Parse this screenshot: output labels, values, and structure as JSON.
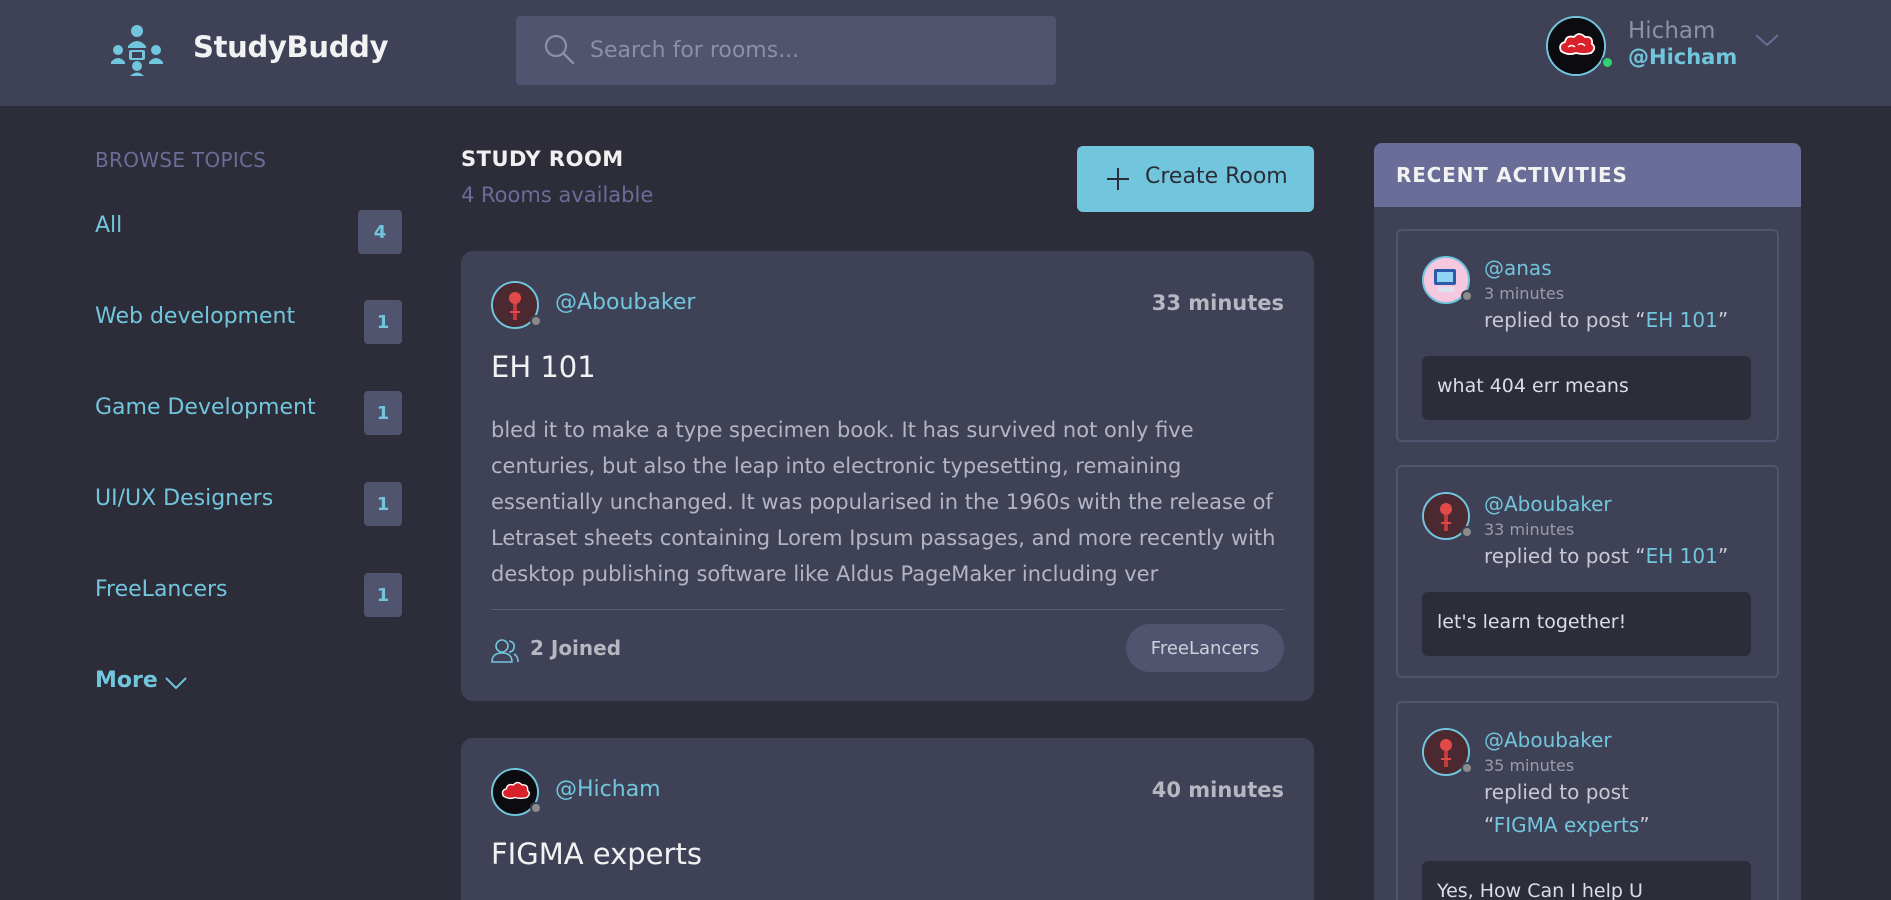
{
  "header": {
    "brand": "StudyBuddy",
    "search_placeholder": "Search for rooms...",
    "user_name": "Hicham",
    "user_handle": "@Hicham"
  },
  "sidebar": {
    "title": "BROWSE TOPICS",
    "topics": [
      {
        "label": "All",
        "count": "4"
      },
      {
        "label": "Web development",
        "count": "1"
      },
      {
        "label": "Game Development",
        "count": "1"
      },
      {
        "label": "UI/UX Designers",
        "count": "1"
      },
      {
        "label": "FreeLancers",
        "count": "1"
      }
    ],
    "more_label": "More"
  },
  "main": {
    "title": "STUDY ROOM",
    "subtitle": "4 Rooms available",
    "create_label": "Create Room",
    "rooms": [
      {
        "host": "@Aboubaker",
        "time": "33 minutes",
        "title": "EH 101",
        "description": "bled it to make a type specimen book. It has survived not only five centuries, but also the leap into electronic typesetting, remaining essentially unchanged. It was popularised in the 1960s with the release of Letraset sheets containing Lorem Ipsum passages, and more recently with desktop publishing software like Aldus PageMaker including ver",
        "joined": "2 Joined",
        "topic": "FreeLancers"
      },
      {
        "host": "@Hicham",
        "time": "40 minutes",
        "title": "FIGMA experts"
      }
    ]
  },
  "activities": {
    "title": "RECENT ACTIVITIES",
    "items": [
      {
        "user": "@anas",
        "time": "3 minutes",
        "prefix": "replied to post “",
        "post": "EH 101",
        "suffix": "”",
        "reply": "what 404 err means"
      },
      {
        "user": "@Aboubaker",
        "time": "33 minutes",
        "prefix": "replied to post “",
        "post": "EH 101",
        "suffix": "”",
        "reply": "let's learn together!"
      },
      {
        "user": "@Aboubaker",
        "time": "35 minutes",
        "prefix": "replied to post “",
        "post": "FIGMA experts",
        "suffix": "”",
        "reply": "Yes, How Can I help U"
      }
    ]
  },
  "colors": {
    "background": "#2d2d39",
    "panel": "#3f4156",
    "accent": "#71c6dd",
    "muted_purple": "#696d97",
    "online": "#2fd171",
    "offline": "#8b8b8b"
  },
  "icons": {
    "logo": "study-group-logo-icon",
    "search": "search-icon",
    "dropdown": "chevron-down-icon",
    "create": "plus-icon",
    "joined": "users-icon"
  }
}
